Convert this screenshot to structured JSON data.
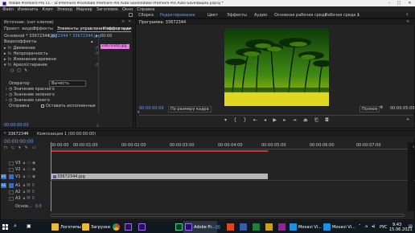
{
  "titlebar": {
    "title": "Adobe Premiere Pro CC - D:\\Premiere Pro\\Adobe Premiere Pro Auto-Save\\Adobe Premiere Pro Auto-Save\\видео.prproj *"
  },
  "menu": [
    "Файл",
    "Изменить",
    "Клип",
    "Эпизод",
    "Маркер",
    "Заголовок",
    "Окно",
    "Справка"
  ],
  "workspace": {
    "items": [
      "Сборка",
      "Редактирование",
      "Цвет",
      "Эффекты",
      "Аудио",
      "Основная рабочая среда",
      "Рабочая среда 1"
    ]
  },
  "source_panel": {
    "tabs": [
      "Источник: (нет клипов)",
      "Проект: видео",
      "Эффекты",
      "Элементы управления эффектами",
      "Микшер аудиоклипов: 33672344"
    ],
    "master_label": "Основной * 33672344.jpg",
    "seq_label": "33672344 * 33672344.jpg",
    "clip_time": "00:00",
    "clip_name": "33672344.jpg",
    "section": "Видеоэффекты",
    "effects": [
      "Движение",
      "Непрозрачность",
      "Изменение времени",
      "Ареол/стирание"
    ],
    "props": [
      {
        "name": "Оператор",
        "value": "Вычесть"
      },
      {
        "name": "Значение красного",
        "value": ""
      },
      {
        "name": "Значение зеленого",
        "value": ""
      },
      {
        "name": "Значение синего",
        "value": ""
      },
      {
        "name": "Отправка",
        "value": "Оставить исполненные"
      }
    ],
    "timecode": "00:00:00:00"
  },
  "program_panel": {
    "title": "Программа: 33672344",
    "timecode_left": "00:00:00:00",
    "fit": "По размеру кадра",
    "quality": "Полное",
    "timecode_right": "00:00:05:00"
  },
  "timeline": {
    "tab": "33672344",
    "tab2": "Композиция 1 (00:00:00:00)",
    "timecode": "00:00:00:00",
    "ruler": [
      "00:00:00",
      "00:00:01:00",
      "00:00:02:00",
      "00:00:03:00",
      "00:00:04:00",
      "00:00:05:00",
      "00:00:06:00",
      "00:00:07:00",
      "00:00:08:00"
    ],
    "tracks": [
      "V3",
      "V2",
      "V1",
      "A1",
      "A2",
      "A3"
    ],
    "clip": "33672344.jpg",
    "master": "Основ..."
  },
  "taskbar": {
    "items": [
      "Логотипы",
      "Загрузки",
      "Adobe Pr...",
      "Adobe Pr...",
      "Movavi Vi...",
      "Movavi Vi..."
    ],
    "lang": "РУС",
    "time": "9:43",
    "date": "15.06.2021"
  }
}
